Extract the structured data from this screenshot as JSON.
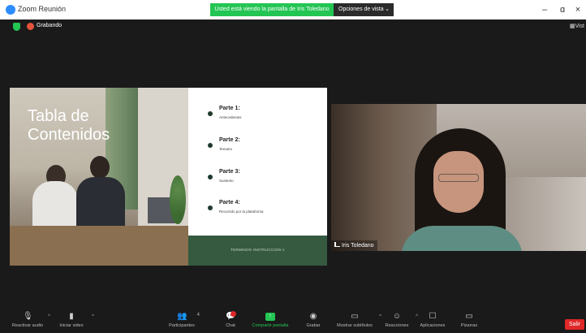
{
  "titlebar": {
    "app_title": "Zoom Reunión",
    "share_banner": "Usted está viendo la pantalla de Iris Toledano",
    "view_options": "Opciones de vista",
    "minimize": "–",
    "maximize": "ɑ",
    "close": "×"
  },
  "status": {
    "recording_label": "Grabando",
    "view_label": "Vist"
  },
  "slide": {
    "title": "Tabla de Contenidos",
    "parts": [
      {
        "title": "Parte 1:",
        "desc": "Antecedentes"
      },
      {
        "title": "Parte 2:",
        "desc": "Temario"
      },
      {
        "title": "Parte 3:",
        "desc": "Sustento"
      },
      {
        "title": "Parte 4:",
        "desc": "Recorrido por la plataforma"
      }
    ],
    "footer": "TERMINOS INSTRUCCION A"
  },
  "video": {
    "participant_name": "Iris Toledano"
  },
  "toolbar": {
    "items": [
      {
        "label": "Reactivar audio",
        "icon": "muted-microphone-icon"
      },
      {
        "label": "Iniciar video",
        "icon": "video-off-icon"
      },
      {
        "label": "Participantes",
        "icon": "participants-icon"
      },
      {
        "label": "Chat",
        "icon": "chat-icon"
      },
      {
        "label": "Compartir pantalla",
        "icon": "share-screen-icon"
      },
      {
        "label": "Grabar",
        "icon": "record-icon"
      },
      {
        "label": "Mostrar subtítulos",
        "icon": "captions-icon"
      },
      {
        "label": "Reacciones",
        "icon": "reactions-icon"
      },
      {
        "label": "Aplicaciones",
        "icon": "apps-icon"
      },
      {
        "label": "Pizarras",
        "icon": "whiteboard-icon"
      }
    ],
    "participant_count": "4",
    "leave": "Salir"
  },
  "colors": {
    "share_green": "#23c553",
    "leave_red": "#e02828",
    "slide_footer_green": "#355a40"
  }
}
